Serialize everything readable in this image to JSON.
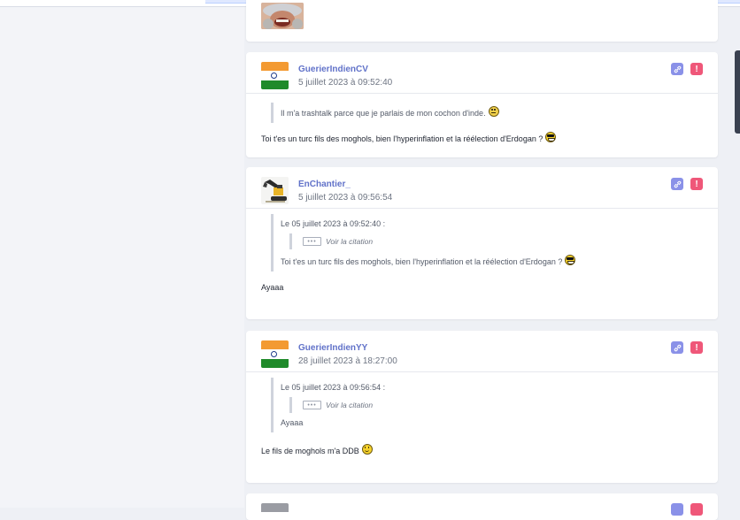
{
  "colors": {
    "accent": "#6172c9",
    "link_button": "#8a91e8",
    "alert_button": "#ef5779"
  },
  "posts": [
    {
      "author": "GuerierIndienCV",
      "date": "5 juillet 2023 à 09:52:40",
      "avatar": "india-flag-icon",
      "quote_text": "Il m'a trashtalk parce que je parlais de mon cochon d'inde.",
      "message": "Toi t'es un turc fils des moghols, bien l'hyperinflation et la réélection d'Erdogan ?"
    },
    {
      "author": "EnChantier_",
      "date": "5 juillet 2023 à 09:56:54",
      "avatar": "excavator-avatar",
      "quote_header": "Le 05 juillet 2023 à 09:52:40 :",
      "voir_citation": "Voir la citation",
      "quote_text": "Toi t'es un turc fils des moghols, bien l'hyperinflation et la réélection d'Erdogan ?",
      "message": "Ayaaa"
    },
    {
      "author": "GuerierIndienYY",
      "date": "28 juillet 2023 à 18:27:00",
      "avatar": "india-flag-icon",
      "quote_header": "Le 05 juillet 2023 à 09:56:54 :",
      "voir_citation": "Voir la citation",
      "quote_text": "Ayaaa",
      "message": "Le fils de moghols m'a DDB"
    }
  ],
  "icons": {
    "link": "link-icon",
    "alert": "exclamation-icon",
    "collapsed_quote": "ellipsis-icon"
  }
}
